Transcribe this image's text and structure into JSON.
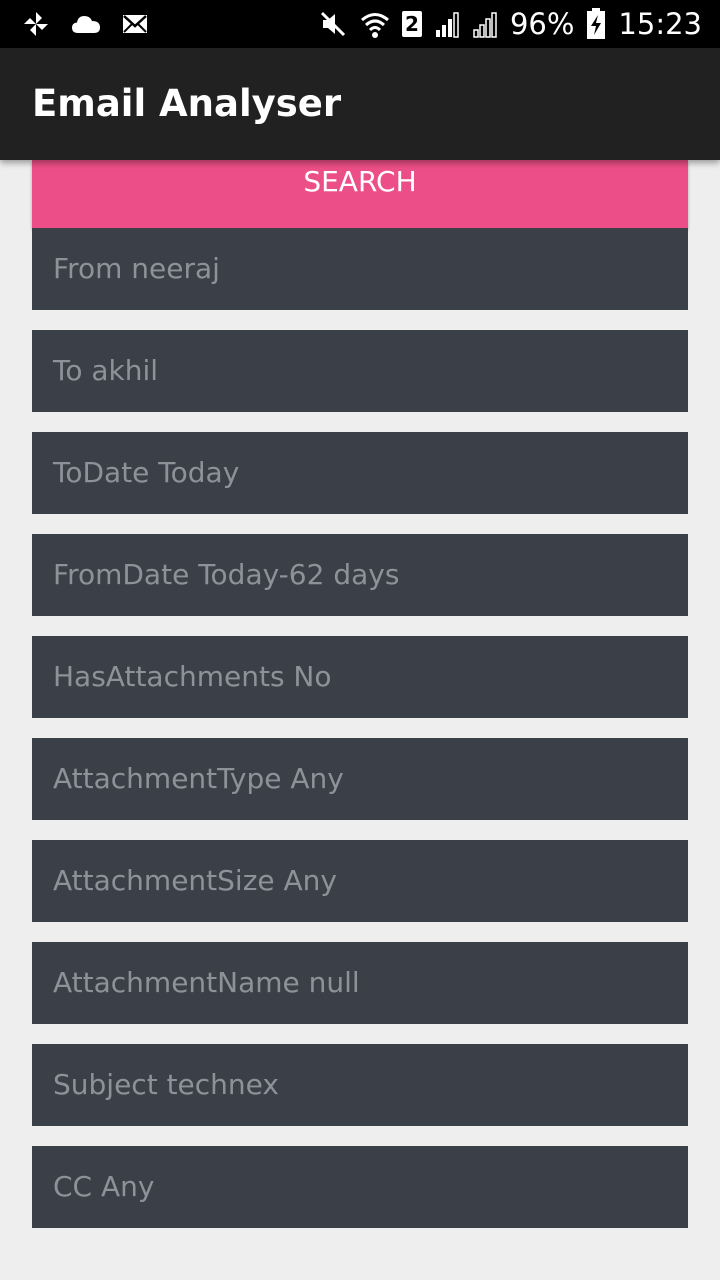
{
  "status_bar": {
    "left_icons": [
      "pinwheel-icon",
      "cloud-icon",
      "mail-icon"
    ],
    "right_icons": [
      "mute-icon",
      "wifi-icon",
      "sim-icon",
      "signal-icon",
      "signal-icon-2",
      "battery-charging-icon"
    ],
    "sim_number": "2",
    "battery": "96%",
    "time": "15:23"
  },
  "app_bar": {
    "title": "Email Analyser"
  },
  "search": {
    "label": "SEARCH",
    "color": "#ec4f87"
  },
  "fields": [
    {
      "name": "from-field",
      "text": "From neeraj"
    },
    {
      "name": "to-field",
      "text": "To akhil"
    },
    {
      "name": "todate-field",
      "text": "ToDate Today"
    },
    {
      "name": "fromdate-field",
      "text": "FromDate Today-62 days"
    },
    {
      "name": "has-attachments-field",
      "text": "HasAttachments No"
    },
    {
      "name": "attachment-type-field",
      "text": "AttachmentType Any"
    },
    {
      "name": "attachment-size-field",
      "text": "AttachmentSize Any"
    },
    {
      "name": "attachment-name-field",
      "text": "AttachmentName null"
    },
    {
      "name": "subject-field",
      "text": "Subject technex"
    },
    {
      "name": "cc-field",
      "text": "CC Any"
    }
  ],
  "colors": {
    "status_bar": "#000000",
    "app_bar": "#212121",
    "background": "#eeeeee",
    "field_background": "#3b4048",
    "field_text": "#8e9198"
  }
}
